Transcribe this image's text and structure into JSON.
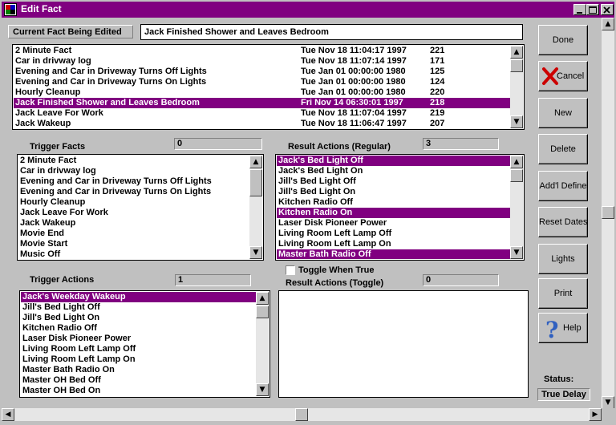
{
  "window": {
    "title": "Edit Fact"
  },
  "current_fact": {
    "label": "Current Fact Being Edited",
    "value": "Jack Finished Shower and Leaves Bedroom"
  },
  "fact_list": [
    {
      "name": "2 Minute Fact",
      "date": "Tue Nov 18 11:04:17 1997",
      "id": "221",
      "selected": false
    },
    {
      "name": "Car in drivway log",
      "date": "Tue Nov 18 11:07:14 1997",
      "id": "171",
      "selected": false
    },
    {
      "name": "Evening and Car in Driveway Turns Off Lights",
      "date": "Tue Jan 01 00:00:00 1980",
      "id": "125",
      "selected": false
    },
    {
      "name": "Evening and Car in Driveway Turns On Lights",
      "date": "Tue Jan 01 00:00:00 1980",
      "id": "124",
      "selected": false
    },
    {
      "name": "Hourly Cleanup",
      "date": "Tue Jan 01 00:00:00 1980",
      "id": "220",
      "selected": false
    },
    {
      "name": "Jack Finished Shower and Leaves Bedroom",
      "date": "Fri Nov 14 06:30:01 1997",
      "id": "218",
      "selected": true
    },
    {
      "name": "Jack Leave For Work",
      "date": "Tue Nov 18 11:07:04 1997",
      "id": "219",
      "selected": false
    },
    {
      "name": "Jack Wakeup",
      "date": "Tue Nov 18 11:06:47 1997",
      "id": "207",
      "selected": false
    }
  ],
  "trigger_facts": {
    "label": "Trigger Facts",
    "count": "0",
    "items": [
      {
        "text": "2 Minute Fact",
        "selected": false
      },
      {
        "text": "Car in drivway log",
        "selected": false
      },
      {
        "text": "Evening and Car in Driveway Turns Off Lights",
        "selected": false
      },
      {
        "text": "Evening and Car in Driveway Turns On Lights",
        "selected": false
      },
      {
        "text": "Hourly Cleanup",
        "selected": false
      },
      {
        "text": "Jack Leave For Work",
        "selected": false
      },
      {
        "text": "Jack Wakeup",
        "selected": false
      },
      {
        "text": "Movie End",
        "selected": false
      },
      {
        "text": "Movie Start",
        "selected": false
      },
      {
        "text": "Music Off",
        "selected": false
      }
    ]
  },
  "result_actions_regular": {
    "label": "Result Actions (Regular)",
    "count": "3",
    "items": [
      {
        "text": "Jack's Bed Light Off",
        "selected": true
      },
      {
        "text": "Jack's Bed Light On",
        "selected": false
      },
      {
        "text": "Jill's Bed Light Off",
        "selected": false
      },
      {
        "text": "Jill's Bed Light On",
        "selected": false
      },
      {
        "text": "Kitchen Radio Off",
        "selected": false
      },
      {
        "text": "Kitchen Radio On",
        "selected": true
      },
      {
        "text": "Laser Disk Pioneer Power",
        "selected": false
      },
      {
        "text": "Living Room Left Lamp Off",
        "selected": false
      },
      {
        "text": "Living Room Left Lamp On",
        "selected": false
      },
      {
        "text": "Master Bath Radio Off",
        "selected": true
      }
    ]
  },
  "trigger_actions": {
    "label": "Trigger Actions",
    "count": "1",
    "items": [
      {
        "text": "Jack's Weekday Wakeup",
        "selected": true
      },
      {
        "text": "Jill's Bed Light Off",
        "selected": false
      },
      {
        "text": "Jill's Bed Light On",
        "selected": false
      },
      {
        "text": "Kitchen Radio Off",
        "selected": false
      },
      {
        "text": "Laser Disk Pioneer Power",
        "selected": false
      },
      {
        "text": "Living Room Left Lamp Off",
        "selected": false
      },
      {
        "text": "Living Room Left Lamp On",
        "selected": false
      },
      {
        "text": "Master Bath Radio On",
        "selected": false
      },
      {
        "text": "Master OH Bed Off",
        "selected": false
      },
      {
        "text": "Master OH Bed On",
        "selected": false
      }
    ]
  },
  "toggle": {
    "label": "Toggle When True",
    "checked": false
  },
  "result_actions_toggle": {
    "label": "Result Actions (Toggle)",
    "count": "0",
    "items": []
  },
  "buttons": {
    "done": "Done",
    "cancel": "Cancel",
    "new": "New",
    "delete": "Delete",
    "addl_define": "Add'l Define",
    "reset_dates": "Reset Dates",
    "lights": "Lights",
    "print": "Print",
    "help": "Help"
  },
  "status": {
    "label": "Status:",
    "value": "True Delay"
  },
  "colors": {
    "title_bar": "#800080",
    "selection": "#800080",
    "face": "#c0c0c0",
    "cancel_x": "#cc0000",
    "help_icon": "#3060c0"
  }
}
